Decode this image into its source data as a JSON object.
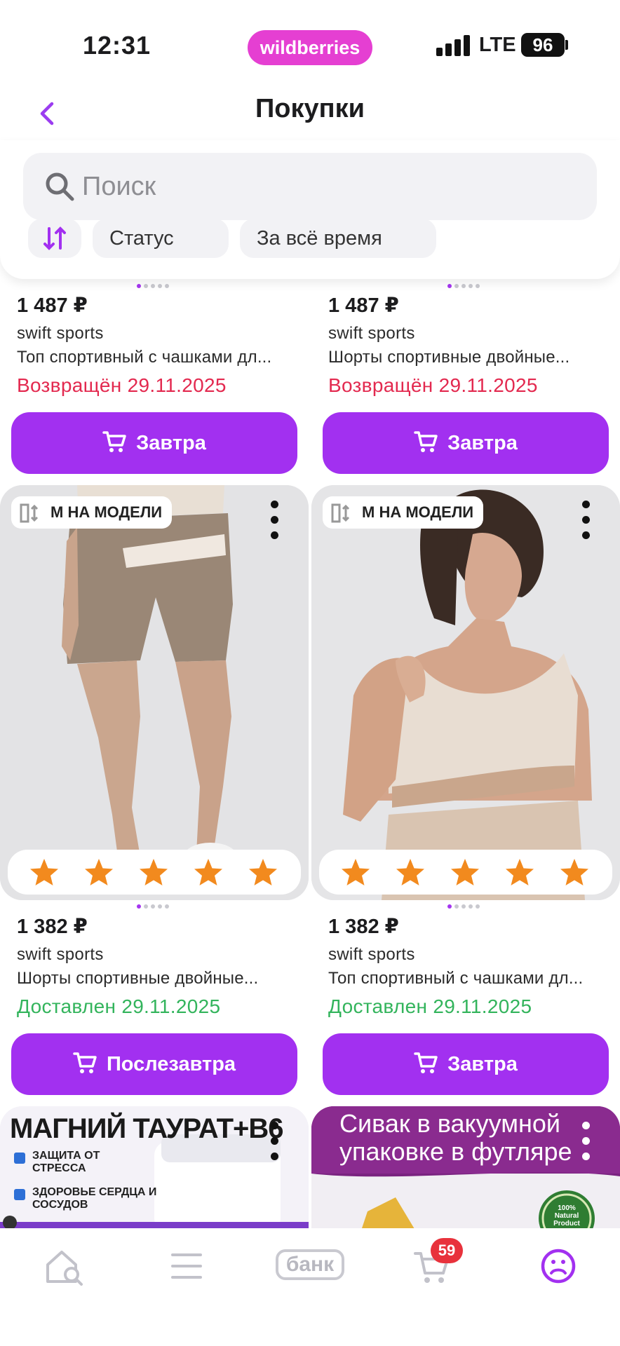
{
  "status_bar": {
    "time": "12:31",
    "brand": "wildberries",
    "network": "LTE",
    "battery": "96"
  },
  "header": {
    "title": "Покупки"
  },
  "search": {
    "placeholder": "Поиск"
  },
  "filters": {
    "items": [
      "Статус",
      "За всё время"
    ]
  },
  "products": [
    {
      "price": "1 487 ₽",
      "brand": "swift sports",
      "name": "Топ спортивный с чашками дл...",
      "status": "Возвращён 29.11.2025",
      "status_type": "returned",
      "button": "Завтра"
    },
    {
      "price": "1 487 ₽",
      "brand": "swift sports",
      "name": "Шорты спортивные двойные...",
      "status": "Возвращён 29.11.2025",
      "status_type": "returned",
      "button": "Завтра"
    },
    {
      "badge": "М НА МОДЕЛИ",
      "rating": 5,
      "price": "1 382 ₽",
      "brand": "swift sports",
      "name": "Шорты спортивные двойные...",
      "status": "Доставлен 29.11.2025",
      "status_type": "delivered",
      "button": "Послезавтра"
    },
    {
      "badge": "М НА МОДЕЛИ",
      "rating": 5,
      "price": "1 382 ₽",
      "brand": "swift sports",
      "name": "Топ спортивный с чашками дл...",
      "status": "Доставлен 29.11.2025",
      "status_type": "delivered",
      "button": "Завтра"
    }
  ],
  "ads": [
    {
      "title": "МАГНИЙ ТАУРАТ+B6",
      "points": [
        "ЗАЩИТА ОТ СТРЕССА",
        "ЗДОРОВЬЕ СЕРДЦА И СОСУДОВ"
      ]
    },
    {
      "title_line1": "Сивак в вакуумной",
      "title_line2": "упаковке в футляре",
      "seal": "100% Natural Product"
    }
  ],
  "bottom_nav": {
    "bank": "банк",
    "cart_count": "59",
    "icons": [
      "home-search-icon",
      "menu-icon",
      "bank-icon",
      "cart-icon",
      "profile-icon"
    ]
  },
  "colors": {
    "accent": "#a230f0",
    "brand_pill": "#e53fd2",
    "returned": "#e3294f",
    "delivered": "#33b45c",
    "badge": "#e8323c",
    "star": "#f28a1e"
  }
}
